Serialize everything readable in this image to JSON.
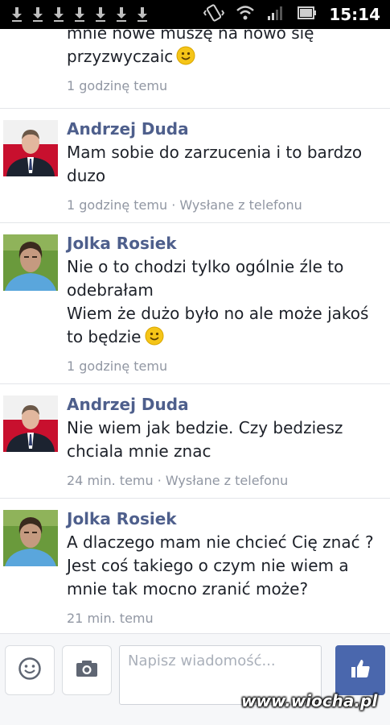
{
  "status_bar": {
    "notification_icons": [
      "download-icon",
      "download-icon",
      "download-icon",
      "download-icon",
      "download-icon",
      "download-icon",
      "download-icon"
    ],
    "system_icons": [
      "vibrate-icon",
      "wifi-icon",
      "signal-icon",
      "battery-icon"
    ],
    "time": "15:14"
  },
  "messages": [
    {
      "sender": "",
      "lines": [
        "mnie nowe muszę na nowo się",
        "przyzwyczaic"
      ],
      "smiley_on_last_line": true,
      "meta": "1 godzinę temu"
    },
    {
      "sender": "Andrzej Duda",
      "lines": [
        "Mam sobie do zarzucenia i to bardzo",
        "duzo"
      ],
      "smiley_on_last_line": false,
      "meta": "1 godzinę temu · Wysłane z telefonu"
    },
    {
      "sender": "Jolka Rosiek",
      "lines": [
        "Nie o to chodzi tylko ogólnie źle to",
        "odebrałam",
        "Wiem że dużo było no ale może jakoś",
        "to będzie"
      ],
      "smiley_on_last_line": true,
      "meta": "1 godzinę temu"
    },
    {
      "sender": "Andrzej Duda",
      "lines": [
        "Nie wiem jak bedzie. Czy bedziesz",
        "chciala mnie znac"
      ],
      "smiley_on_last_line": false,
      "meta": "24 min. temu · Wysłane z telefonu"
    },
    {
      "sender": "Jolka Rosiek",
      "lines": [
        "A dlaczego mam nie chcieć Cię znać ?",
        "Jest coś takiego o czym nie wiem a",
        "mnie tak mocno zranić może?"
      ],
      "smiley_on_last_line": false,
      "meta": "21 min. temu"
    }
  ],
  "composer": {
    "emoji_icon": "smiley-icon",
    "camera_icon": "camera-icon",
    "placeholder": "Napisz wiadomość...",
    "like_icon": "thumbs-up-icon"
  },
  "watermark": "www.wiocha.pl",
  "colors": {
    "sender_name": "#4e5f8c",
    "meta_text": "#9197a3",
    "like_button": "#4a67ad",
    "smiley": "#f5c518"
  }
}
